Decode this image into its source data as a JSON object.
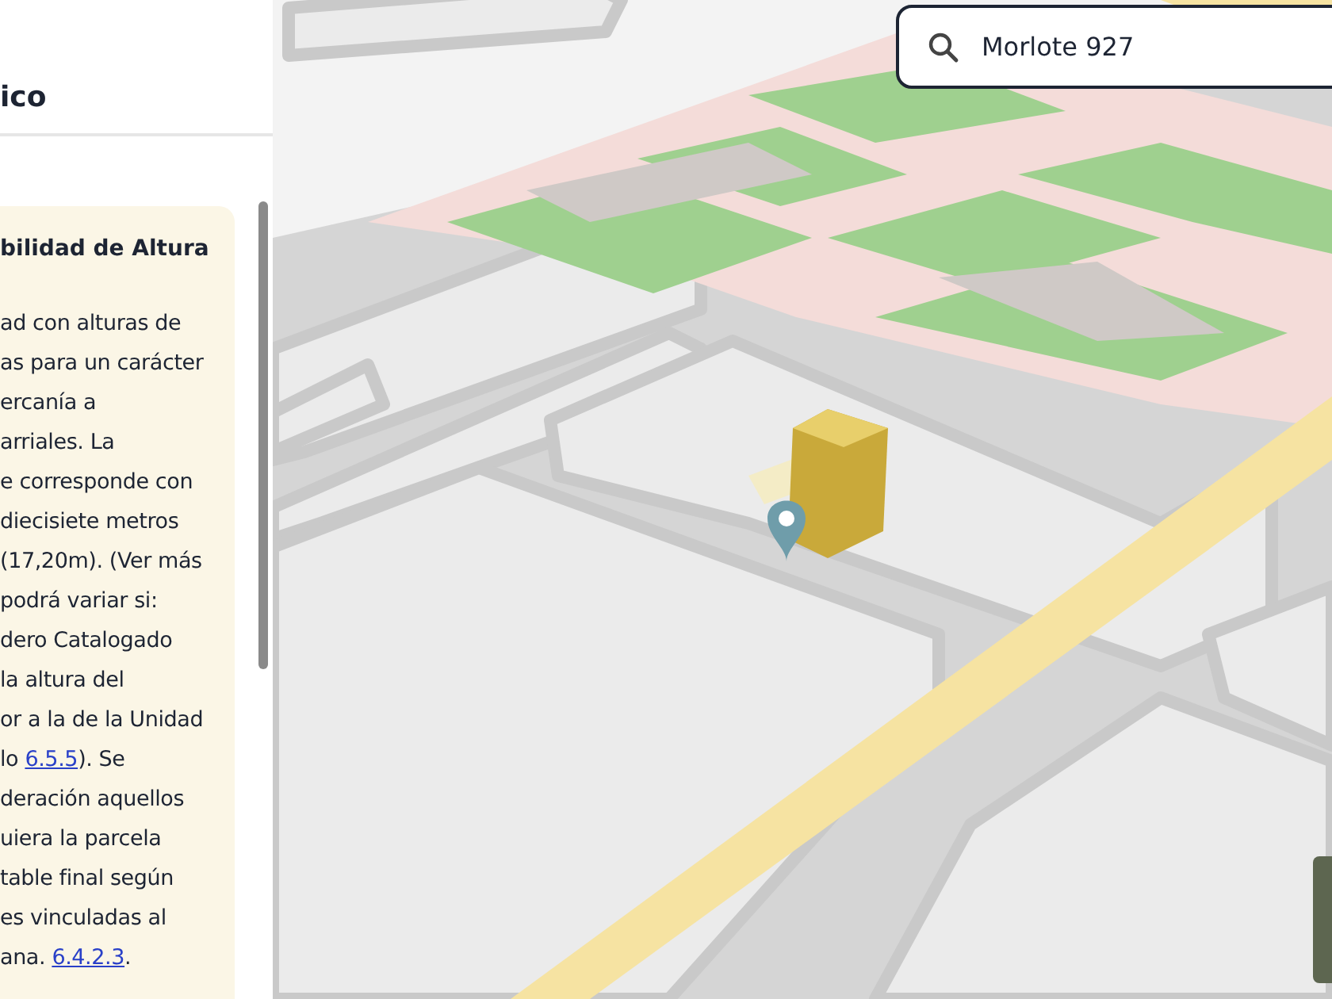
{
  "panel": {
    "title": "ico",
    "card": {
      "heading": "bilidad de Altura",
      "lines": [
        {
          "text": "ad con alturas de"
        },
        {
          "text": "as para un carácter"
        },
        {
          "text": "ercanía a"
        },
        {
          "text": "arriales. La"
        },
        {
          "text": "e corresponde con"
        },
        {
          "text": "diecisiete metros"
        },
        {
          "text": "(17,20m). (Ver más"
        },
        {
          "text": "podrá variar si:"
        },
        {
          "text": "dero Catalogado"
        },
        {
          "text": "la altura del"
        },
        {
          "text": "or a la de la Unidad"
        },
        {
          "text": "lo ",
          "link": "6.5.5",
          "after": "). Se"
        },
        {
          "text": "deración aquellos"
        },
        {
          "text": "uiera la parcela"
        },
        {
          "text": "table final según"
        },
        {
          "text": "es vinculadas al"
        },
        {
          "text": "ana. ",
          "link": "6.4.2.3",
          "after": "."
        }
      ]
    }
  },
  "search": {
    "value": "Morlote 927"
  }
}
